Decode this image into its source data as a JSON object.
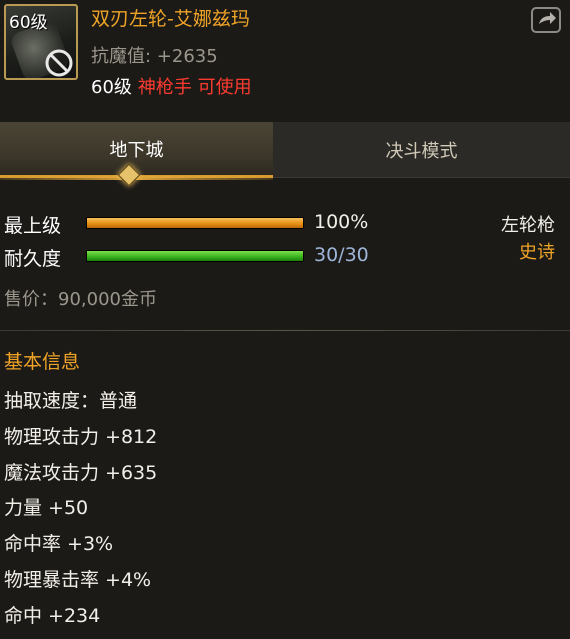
{
  "item": {
    "level_tag": "60级",
    "name": "双刃左轮-艾娜兹玛",
    "resist_label": "抗魔值",
    "resist_value": "+2635",
    "req_level": "60级",
    "req_class": "神枪手 可使用"
  },
  "tabs": [
    {
      "label": "地下城",
      "active": true
    },
    {
      "label": "决斗模式",
      "active": false
    }
  ],
  "stats": {
    "max_level_label": "最上级",
    "max_level_percent": 100,
    "max_level_text": "100%",
    "durability_label": "耐久度",
    "durability_current": 30,
    "durability_max": 30,
    "durability_text": "30/30"
  },
  "weapon_type": "左轮枪",
  "rarity": "史诗",
  "price": "售价：90,000金币",
  "section_title": "基本信息",
  "attributes": [
    "抽取速度：普通",
    "物理攻击力 +812",
    "魔法攻击力 +635",
    "力量 +50",
    "命中率 +3%",
    "物理暴击率 +4%",
    "命中 +234"
  ],
  "colors": {
    "accent_gold": "#f0a427",
    "class_red": "#ff3b30",
    "durability_green": "#36b21c",
    "level_orange": "#e58d12",
    "rarity_color": "#f0a427",
    "durability_text": "#9fb5d8"
  },
  "icons": {
    "share": "share-export-icon",
    "restricted": "no-entry-icon"
  }
}
